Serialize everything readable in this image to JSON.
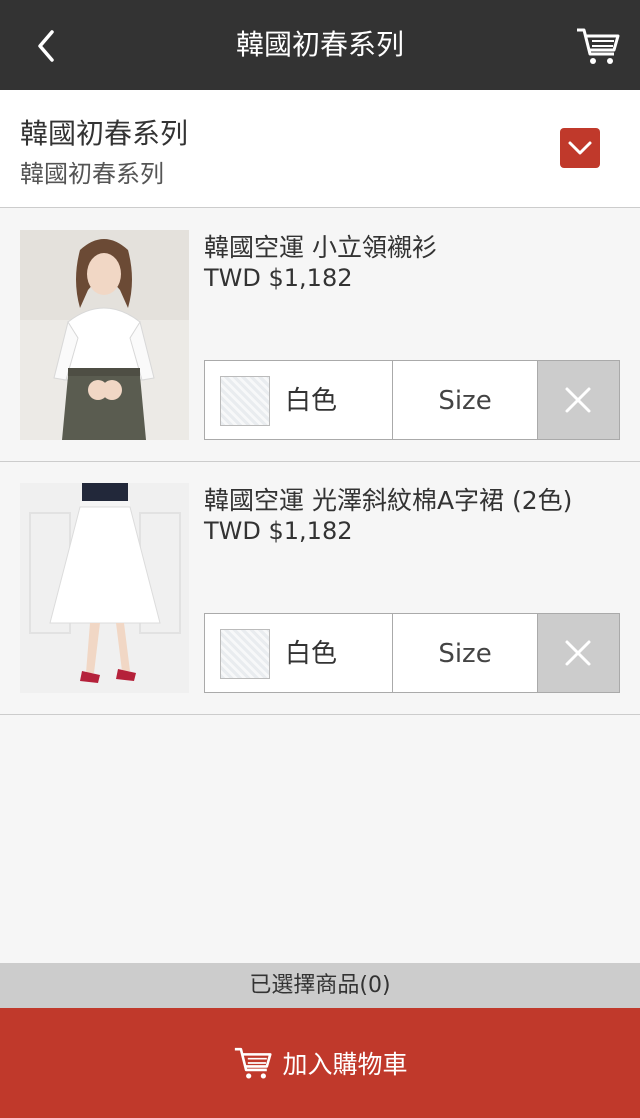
{
  "header": {
    "title": "韓國初春系列",
    "back_icon": "chevron-left-icon",
    "cart_icon": "shopping-cart-icon"
  },
  "series": {
    "title": "韓國初春系列",
    "subtitle": "韓國初春系列",
    "expand_icon": "chevron-down-icon"
  },
  "products": [
    {
      "name": "韓國空運 小立領襯衫",
      "price": "TWD $1,182",
      "color_label": "白色",
      "size_label": "Size",
      "remove_icon": "close-icon"
    },
    {
      "name": "韓國空運 光澤斜紋棉A字裙 (2色)",
      "price": "TWD $1,182",
      "color_label": "白色",
      "size_label": "Size",
      "remove_icon": "close-icon"
    }
  ],
  "footer": {
    "selected_text": "已選擇商品(0)",
    "add_to_cart_label": "加入購物車",
    "cart_icon": "shopping-cart-icon"
  },
  "colors": {
    "header_bg": "#333333",
    "accent": "#c0392b",
    "page_bg": "#f6f6f6",
    "remove_bg": "#cccccc",
    "selected_bar_bg": "#cccccc"
  }
}
